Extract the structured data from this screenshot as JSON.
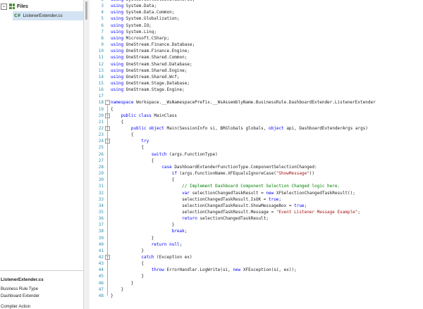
{
  "explorer": {
    "title": "Files",
    "file_name": "ListenerExtender.cs",
    "file_icon_text": "C#"
  },
  "properties": {
    "title": "ListenerExtender.cs",
    "business_rule_type_label": "Business Rule Type",
    "business_rule_type_value": "Dashboard Extender",
    "next_label": "Compiler Action"
  },
  "editor": {
    "lines": [
      {
        "n": "2",
        "t": "using System.Collections.Generic;",
        "h": "using-text"
      },
      {
        "n": "3",
        "t": "using System.Data;",
        "h": "using-text"
      },
      {
        "n": "4",
        "t": "using System.Data.Common;",
        "h": "using-text"
      },
      {
        "n": "5",
        "t": "using System.Globalization;",
        "h": "using-text"
      },
      {
        "n": "6",
        "t": "using System.IO;",
        "h": "using-text"
      },
      {
        "n": "7",
        "t": "using System.Linq;",
        "h": "using-text"
      },
      {
        "n": "8",
        "t": "using Microsoft.CSharp;",
        "h": "using-text"
      },
      {
        "n": "9",
        "t": "using OneStream.Finance.Database;",
        "h": "using-text"
      },
      {
        "n": "10",
        "t": "using OneStream.Finance.Engine;",
        "h": "using-text"
      },
      {
        "n": "11",
        "t": "using OneStream.Shared.Common;",
        "h": "using-text"
      },
      {
        "n": "12",
        "t": "using OneStream.Shared.Database;",
        "h": "using-text"
      },
      {
        "n": "13",
        "t": "using OneStream.Shared.Engine;",
        "h": "using-text"
      },
      {
        "n": "14",
        "t": "using OneStream.Shared.Wcf;",
        "h": "using-text"
      },
      {
        "n": "15",
        "t": "using OneStream.Stage.Database;",
        "h": "using-text"
      },
      {
        "n": "16",
        "t": "using OneStream.Stage.Engine;",
        "h": "using-text"
      },
      {
        "n": "17",
        "t": "",
        "h": ""
      },
      {
        "n": "18",
        "t": "namespace Workspace.__WsNamespacePrefix.__WsAssemblyName.BusinessRule.DashboardExtender.ListenerExtender",
        "h": ""
      },
      {
        "n": "19",
        "t": "{",
        "h": ""
      },
      {
        "n": "20",
        "t": "    public class MainClass",
        "h": ""
      },
      {
        "n": "21",
        "t": "    {",
        "h": ""
      },
      {
        "n": "22",
        "t": "        public object Main(SessionInfo si, BRGlobals globals, object api, DashboardExtenderArgs args)",
        "h": ""
      },
      {
        "n": "23",
        "t": "        {",
        "h": ""
      },
      {
        "n": "24",
        "t": "            try",
        "h": ""
      },
      {
        "n": "25",
        "t": "            {",
        "h": ""
      },
      {
        "n": "26",
        "t": "                switch (args.FunctionType)",
        "h": ""
      },
      {
        "n": "27",
        "t": "                {",
        "h": ""
      },
      {
        "n": "28",
        "t": "                    case DashboardExtenderFunctionType.ComponentSelectionChanged:",
        "h": ""
      },
      {
        "n": "29",
        "t": "                        if (args.FunctionName.XFEqualsIgnoreCase(\"ShowMessage\"))",
        "h": ""
      },
      {
        "n": "30",
        "t": "                        {",
        "h": ""
      },
      {
        "n": "31",
        "t": "                            // Implement Dashboard Component Selection Changed logic here.",
        "h": ""
      },
      {
        "n": "32",
        "t": "                            var selectionChangedTaskResult = new XFSelectionChangedTaskResult();",
        "h": ""
      },
      {
        "n": "33",
        "t": "                            selectionChangedTaskResult.IsOK = true;",
        "h": ""
      },
      {
        "n": "34",
        "t": "                            selectionChangedTaskResult.ShowMessageBox = true;",
        "h": ""
      },
      {
        "n": "35",
        "t": "                            selectionChangedTaskResult.Message = \"Event Listener Message Example\";",
        "h": ""
      },
      {
        "n": "36",
        "t": "                            return selectionChangedTaskResult;",
        "h": ""
      },
      {
        "n": "37",
        "t": "                        }",
        "h": ""
      },
      {
        "n": "38",
        "t": "                        break;",
        "h": ""
      },
      {
        "n": "39",
        "t": "                }",
        "h": ""
      },
      {
        "n": "40",
        "t": "                return null;",
        "h": ""
      },
      {
        "n": "41",
        "t": "            }",
        "h": ""
      },
      {
        "n": "42",
        "t": "            catch (Exception ex)",
        "h": ""
      },
      {
        "n": "43",
        "t": "            {",
        "h": ""
      },
      {
        "n": "44",
        "t": "                throw ErrorHandler.LogWrite(si, new XFException(si, ex));",
        "h": ""
      },
      {
        "n": "45",
        "t": "            }",
        "h": ""
      },
      {
        "n": "46",
        "t": "        }",
        "h": ""
      },
      {
        "n": "47",
        "t": "    }",
        "h": ""
      },
      {
        "n": "48",
        "t": "}",
        "h": ""
      }
    ]
  },
  "colors": {
    "keyword": "#0000ff",
    "string": "#a31515",
    "comment": "#008000",
    "line_number": "#2b91af",
    "selection": "#d3e3f3"
  }
}
